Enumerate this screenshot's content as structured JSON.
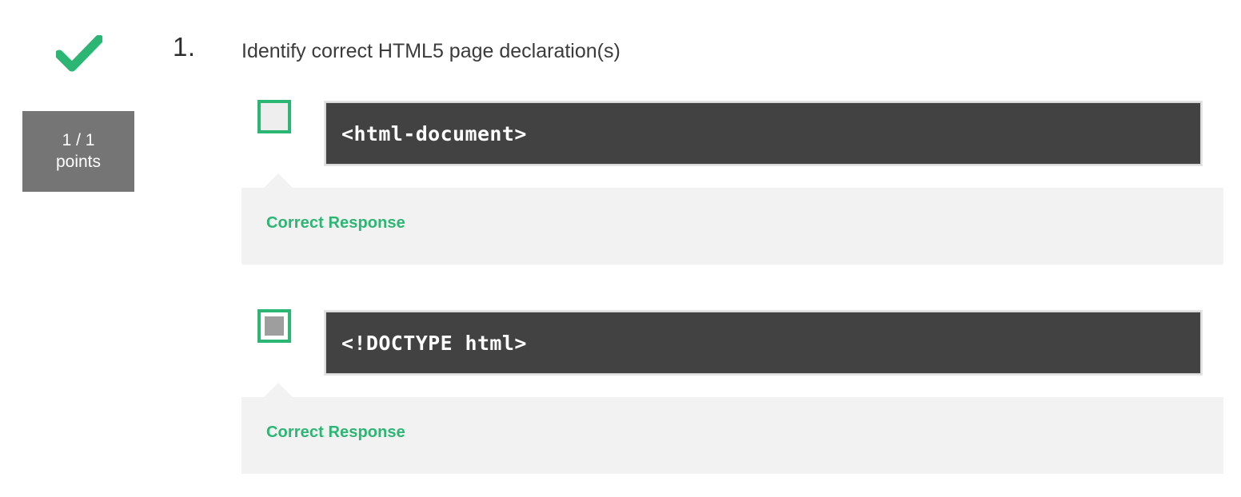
{
  "status": {
    "icon": "check-icon",
    "icon_color": "#2bb673",
    "points_value": "1 / 1",
    "points_label": "points",
    "points_badge_color": "#757575"
  },
  "question": {
    "number": "1.",
    "text": "Identify correct HTML5 page declaration(s)"
  },
  "options": [
    {
      "checkbox_state": "unchecked",
      "checkbox_icon": "checkbox-unchecked-icon",
      "code": "<html-document>",
      "feedback": "Correct Response",
      "feedback_color": "#2bb673"
    },
    {
      "checkbox_state": "checked",
      "checkbox_icon": "checkbox-checked-icon",
      "code": "<!DOCTYPE html>",
      "feedback": "Correct Response",
      "feedback_color": "#2bb673"
    }
  ],
  "theme": {
    "code_background": "#424242",
    "code_text": "#ffffff",
    "panel_background": "#f2f2f2",
    "accent_green": "#2bb673",
    "page_background": "#ffffff"
  }
}
